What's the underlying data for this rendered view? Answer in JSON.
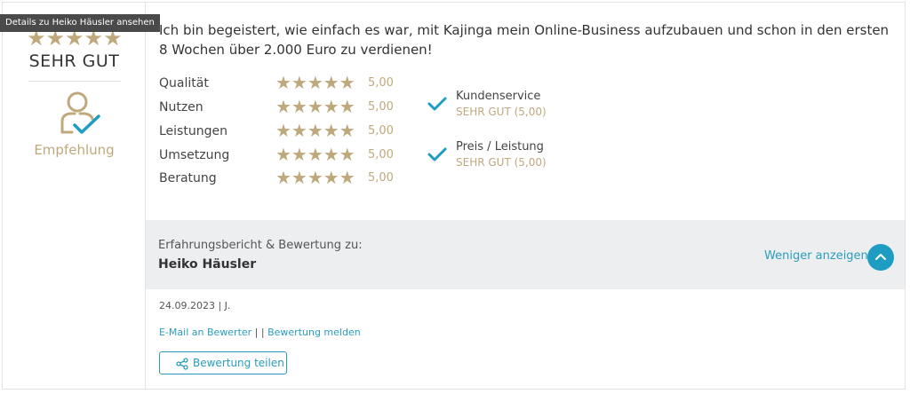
{
  "tooltip": "Details zu Heiko Häusler ansehen",
  "overall": {
    "stars": "★★★★★",
    "rating_count": 5,
    "label": "SEHR GUT"
  },
  "recommendation": {
    "icon": "person-check-icon",
    "label": "Empfehlung"
  },
  "review_text": "Ich bin begeistert, wie einfach es war, mit Kajinga mein Online-Business aufzubauen und schon in den ersten 8 Wochen über 2.000 Euro zu verdienen!",
  "ratings": [
    {
      "label": "Qualität",
      "stars": "★★★★★",
      "value": "5,00"
    },
    {
      "label": "Nutzen",
      "stars": "★★★★★",
      "value": "5,00"
    },
    {
      "label": "Leistungen",
      "stars": "★★★★★",
      "value": "5,00"
    },
    {
      "label": "Umsetzung",
      "stars": "★★★★★",
      "value": "5,00"
    },
    {
      "label": "Beratung",
      "stars": "★★★★★",
      "value": "5,00"
    }
  ],
  "criteria": [
    {
      "name": "Kundenservice",
      "value": "SEHR GUT (5,00)",
      "icon": "checkmark-icon"
    },
    {
      "name": "Preis / Leistung",
      "value": "SEHR GUT (5,00)",
      "icon": "checkmark-icon"
    }
  ],
  "band": {
    "caption": "Erfahrungsbericht & Bewertung zu:",
    "name": "Heiko Häusler",
    "less_label": "Weniger anzeigen",
    "less_icon": "chevron-up-icon"
  },
  "meta": {
    "date_author": "24.09.2023 | J.",
    "email_link": "E-Mail an Bewerter",
    "separator": " | | ",
    "report_link": "Bewertung melden"
  },
  "share": {
    "label": "Bewertung teilen",
    "icon": "share-icon"
  },
  "colors": {
    "gold": "#bfa97c",
    "accent": "#2a9dbd",
    "band_bg": "#eceef0"
  }
}
